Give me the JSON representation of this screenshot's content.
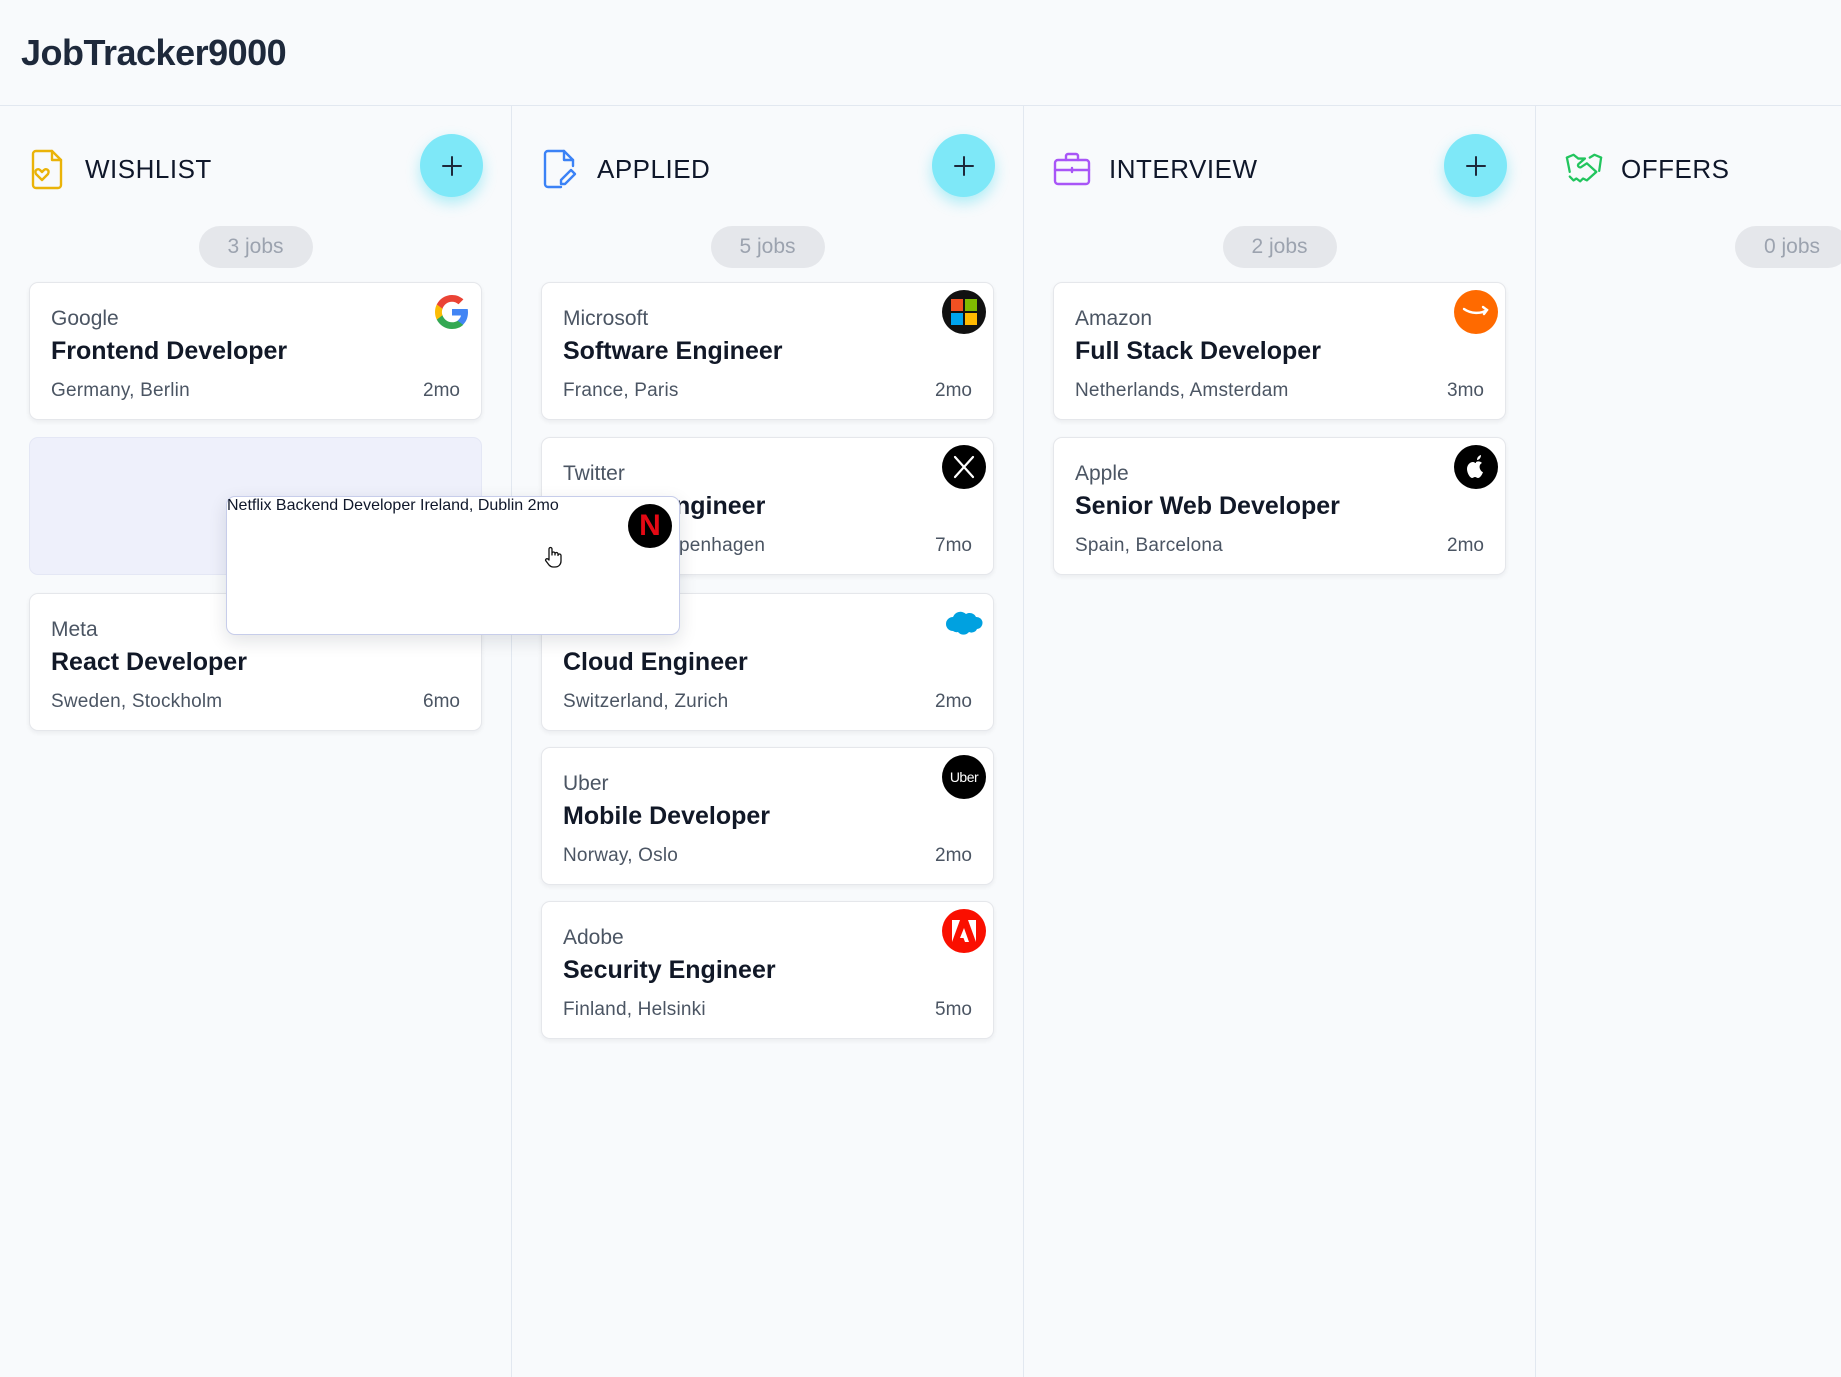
{
  "app": {
    "title": "JobTracker9000"
  },
  "columns": [
    {
      "title": "WISHLIST",
      "count": "3 jobs",
      "icon": "file-heart-icon",
      "color": "#eab308",
      "cards": [
        {
          "company": "Google",
          "role": "Frontend Developer",
          "location": "Germany, Berlin",
          "age": "2mo",
          "logo": "google-logo"
        },
        {
          "company": "Meta",
          "role": "React Developer",
          "location": "Sweden, Stockholm",
          "age": "6mo",
          "logo": "none"
        }
      ]
    },
    {
      "title": "APPLIED",
      "count": "5 jobs",
      "icon": "file-pen-icon",
      "color": "#3b82f6",
      "cards": [
        {
          "company": "Microsoft",
          "role": "Software Engineer",
          "location": "France, Paris",
          "age": "2mo",
          "logo": "microsoft-logo"
        },
        {
          "company": "Twitter",
          "role": "ngineer",
          "location": "penhagen",
          "age": "7mo",
          "logo": "x-logo"
        },
        {
          "company": "",
          "role": "Cloud Engineer",
          "location": "Switzerland, Zurich",
          "age": "2mo",
          "logo": "salesforce-logo"
        },
        {
          "company": "Uber",
          "role": "Mobile Developer",
          "location": "Norway, Oslo",
          "age": "2mo",
          "logo": "uber-logo",
          "logo_text": "Uber"
        },
        {
          "company": "Adobe",
          "role": "Security Engineer",
          "location": "Finland, Helsinki",
          "age": "5mo",
          "logo": "adobe-logo"
        }
      ]
    },
    {
      "title": "INTERVIEW",
      "count": "2 jobs",
      "icon": "briefcase-icon",
      "color": "#a855f7",
      "cards": [
        {
          "company": "Amazon",
          "role": "Full Stack Developer",
          "location": "Netherlands, Amsterdam",
          "age": "3mo",
          "logo": "amazon-logo"
        },
        {
          "company": "Apple",
          "role": "Senior Web Developer",
          "location": "Spain, Barcelona",
          "age": "2mo",
          "logo": "apple-logo"
        }
      ]
    },
    {
      "title": "OFFERS",
      "count": "0 jobs",
      "icon": "handshake-icon",
      "color": "#22c55e",
      "cards": []
    }
  ],
  "dragging": {
    "company": "Netflix",
    "role": "Backend Developer",
    "location": "Ireland, Dublin",
    "age": "2mo",
    "logo": "netflix-logo",
    "logo_text": "N"
  },
  "accent": "#7ee8f8"
}
